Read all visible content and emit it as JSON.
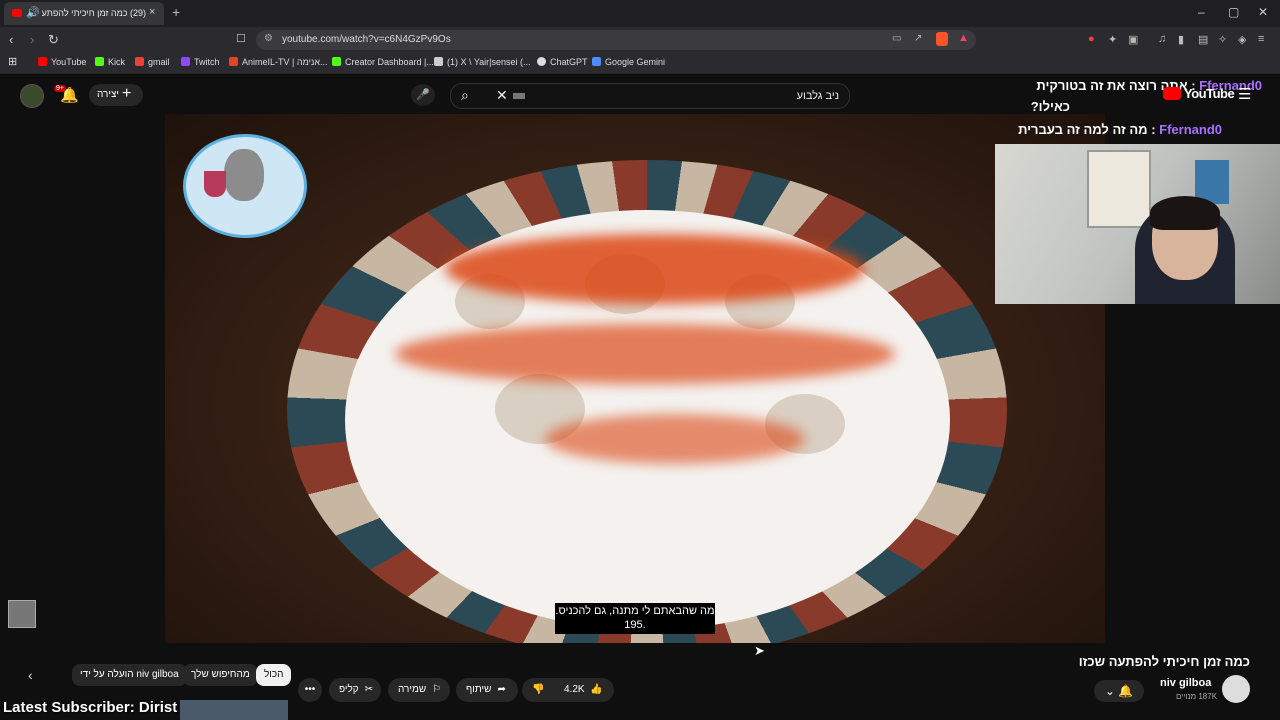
{
  "browser": {
    "tab_title": "(29) כמה זמן חיכיתי להפתעה שכזו",
    "tab_close": "×",
    "new_tab": "+",
    "url": "youtube.com/watch?v=c6N4GzPv9Os",
    "window_controls": [
      "–",
      "▢",
      "✕"
    ]
  },
  "bookmarks": [
    {
      "label": "YouTube",
      "color": "#ff0000"
    },
    {
      "label": "Kick",
      "color": "#53fc18"
    },
    {
      "label": "gmail",
      "color": "#ea4335"
    },
    {
      "label": "Twitch",
      "color": "#9146ff"
    },
    {
      "label": "AnimeIL-TV | אנימה...",
      "color": "#e0452b"
    },
    {
      "label": "Creator Dashboard |...",
      "color": "#53fc18"
    },
    {
      "label": "(1) X \\ Yair|sensei (...",
      "color": "#cccccc"
    },
    {
      "label": "ChatGPT",
      "color": "#dddddd"
    },
    {
      "label": "Google Gemini",
      "color": "#4f8bf9"
    }
  ],
  "youtube": {
    "notif_count": "9+",
    "create_label": "יצירה",
    "search_value": "ניב גלבוע",
    "logo_text": "YouTube"
  },
  "stream": {
    "chat": [
      {
        "name": "Ffernand0",
        "sep": " : ",
        "text": "אתה רוצה את זה בטורקית"
      },
      {
        "name": "",
        "sep": "",
        "text": "כאילו?"
      },
      {
        "name": "Ffernand0",
        "sep": " : ",
        "text": "מה זה למה זה בעברית"
      }
    ],
    "latest_subscriber": "Latest Subscriber: Dirist"
  },
  "video": {
    "subtitle_line1": "מה שהבאתם לי מתנה, גם להכניס.",
    "subtitle_line2": "195."
  },
  "below_video": {
    "title": "כמה זמן חיכיתי להפתעה שכזו",
    "channel": "niv gilboa",
    "subscribers": "187K מנויים",
    "likes": "4.2K",
    "share": "שיתוף",
    "save": "שמירה",
    "clip": "קליפ",
    "more": "•••",
    "chips": [
      "הכול",
      "מהחיפוש שלך",
      "הועלה על ידי niv gilboa"
    ]
  },
  "colors": {
    "accent": "#ff0000",
    "chat_name": "#a970ff"
  }
}
